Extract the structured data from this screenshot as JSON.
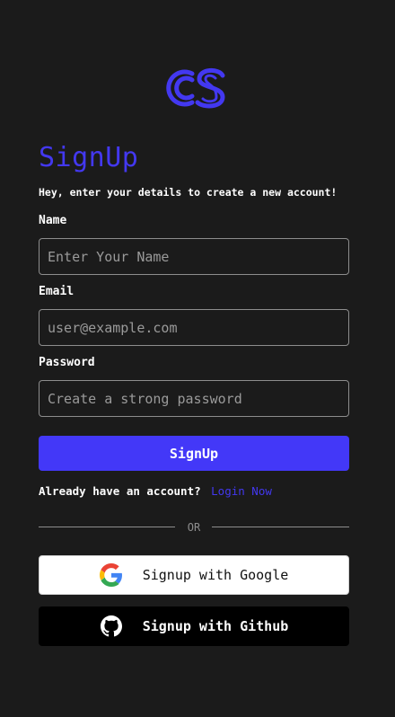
{
  "brand": {
    "logo_text": "CS",
    "accent_color": "#4338f0"
  },
  "form": {
    "title": "SignUp",
    "subtitle": "Hey, enter your details to create a new account!",
    "name": {
      "label": "Name",
      "placeholder": "Enter Your Name",
      "value": ""
    },
    "email": {
      "label": "Email",
      "placeholder": "user@example.com",
      "value": ""
    },
    "password": {
      "label": "Password",
      "placeholder": "Create a strong password",
      "value": ""
    },
    "submit_label": "SignUp"
  },
  "login": {
    "prompt": "Already have an account?",
    "link_label": "Login Now"
  },
  "divider": {
    "text": "OR"
  },
  "social": {
    "google": {
      "label": "Signup with Google",
      "icon": "google-icon"
    },
    "github": {
      "label": "Signup with Github",
      "icon": "github-icon"
    }
  }
}
